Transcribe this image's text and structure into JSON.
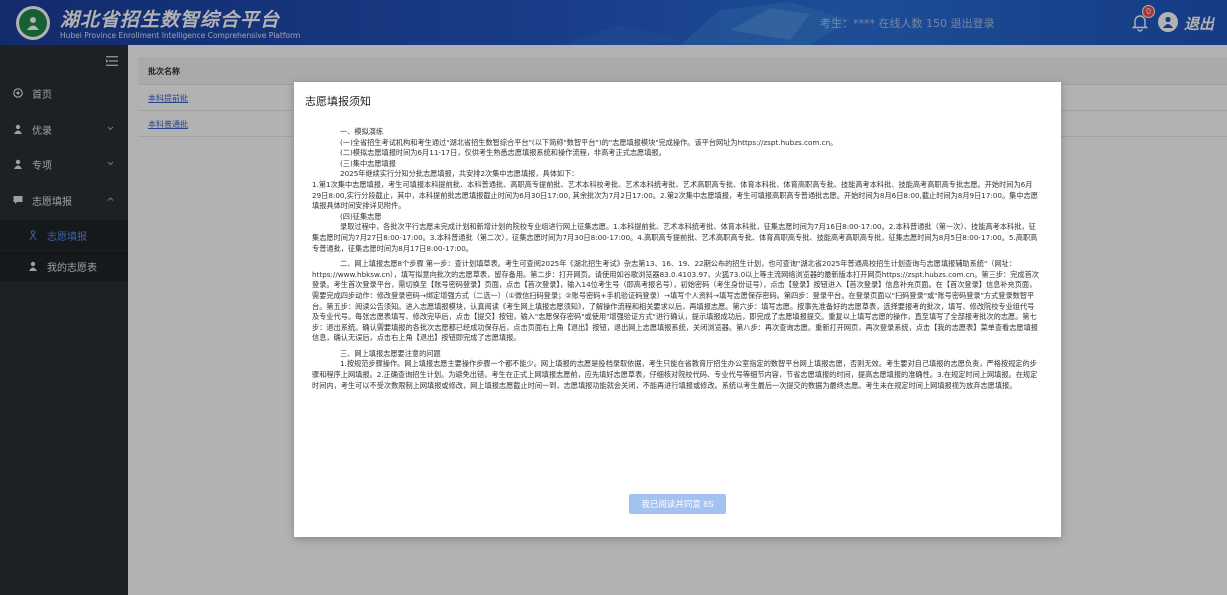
{
  "header": {
    "title": "湖北省招生数智综合平台",
    "subtitle": "Hubei Province Enrollment Intelligence Comprehensive Platform",
    "user_info": "考生：****   在线人数 150   退出登录",
    "notification_count": "0",
    "logout_label": "退出"
  },
  "sidebar": {
    "items": [
      {
        "label": "首页",
        "icon": "home-icon"
      },
      {
        "label": "优录",
        "icon": "user-icon"
      },
      {
        "label": "专项",
        "icon": "user-icon"
      },
      {
        "label": "志愿填报",
        "icon": "chat-icon"
      },
      {
        "label": "志愿填报",
        "icon": "person-icon"
      },
      {
        "label": "我的志愿表",
        "icon": "person-icon"
      }
    ]
  },
  "main": {
    "table": {
      "header": "批次名称",
      "rows": [
        "本科提前批",
        "本科普通批"
      ]
    }
  },
  "modal": {
    "title": "志愿填报须知",
    "paragraphs": [
      {
        "text": "一、模拟演练",
        "indent": true
      },
      {
        "text": "(一)全省招生考试机构和考生通过\"湖北省招生数智综合平台\"(以下简称\"数智平台\")的\"志愿填报模块\"完成操作。该平台网址为https://zspt.hubzs.com.cn。",
        "indent": true
      },
      {
        "text": "(二)模拟志愿填报时间为6月11-17日，仅供考生熟悉志愿填报系统和操作流程，非高考正式志愿填报。",
        "indent": true
      },
      {
        "text": "(三)集中志愿填报",
        "indent": true
      },
      {
        "text": "2025年继续实行分知分批志愿填报，共安排2次集中志愿填报，具体如下：",
        "indent": true
      },
      {
        "text": "1.第1次集中志愿填报，考生可填报本科提前批、本科普通批、高职高专提前批、艺术本科校考批、艺术本科统考批、艺术高职高专批、体育本科批、体育高职高专批、技能高考本科批、技能高考高职高专批志愿。开始时间为6月29日8:00,实行分段截止，其中，本科提前批志愿填报截止时间为6月30日17:00, 其余批次为7月2日17:00。2.第2次集中志愿填报，考生可填报高职高专普通批志愿。开始时间为8月6日8:00,截止时间为8月9日17:00。集中志愿填报具体时间安排详见附件。",
        "indent": false
      },
      {
        "text": "(四)征集志愿",
        "indent": true
      },
      {
        "text": "录取过程中，各批次平行志愿未完成计划和新增计划的院校专业组进行网上征集志愿。1.本科提前批、艺术本科统考批、体育本科批，征集志愿时间为7月16日8:00-17:00。2.本科普通批（第一次）、技能高考本科批，征集志愿时间为7月27日8:00-17:00。3.本科普通批（第二次），征集志愿时间为7月30日8:00-17:00。4.高职高专提前批、艺术高职高专批、体育高职高专批、技能高考高职高专批，征集志愿时间为8月5日8:00-17:00。5.高职高专普通批，征集志愿时间为8月17日8:00-17:00。",
        "indent": true
      },
      {
        "text": "",
        "indent": false
      },
      {
        "text": "二、网上填报志愿8个步骤 第一步：查计划填草表。考生可查阅2025年《湖北招生考试》杂志第13、16、19、22期公布的招生计划，也可查询\"湖北省2025年普通高校招生计划查询与志愿填报辅助系统\"（网址：https://www.hbksw.cn），填写拟意向批次的志愿草表，留存备用。第二步：打开网页。请使用如谷歌浏览器83.0.4103.97、火狐73.0以上等主流网络浏览器的最新版本打开网页https://zspt.hubzs.com.cn。第三步：完成首次登录。考生首次登录平台，需切换至【账号密码登录】页面，点击【首次登录】，输入14位考生号（即高考报名号），初始密码（考生身份证号），点击【登录】按钮进入【首次登录】信息补充页面。在【首次登录】信息补充页面，需要完成四步动作：修改登录密码→绑定增强方式（二选一）（①微信扫码登录；②账号密码+手机验证码登录）→填写个人资料→填写志愿保存密码。第四步：登录平台。在登录页面以\"扫码登录\"或\"账号密码登录\"方式登录数智平台。第五步：阅读公告须知。进入志愿填报模块，认真阅读《考生网上填报志愿须知》，了解操作流程和相关要求以后，再填报志愿。第六步：填写志愿。按事先准备好的志愿草表，选择要报考的批次，填写、修改院校专业组代号及专业代号。每张志愿表填写、修改完毕后，点击【提交】按钮，输入\"志愿保存密码\"或使用\"增强验证方式\"进行确认，提示填报成功后，即完成了志愿填报提交。重复以上填写志愿的操作，直至填写了全部报考批次的志愿。第七步：退出系统。确认需要填报的各批次志愿都已经成功保存后，点击页面右上角【退出】按钮，退出网上志愿填报系统，关闭浏览器。第八步：再次查询志愿。重新打开网页，再次登录系统，点击【我的志愿表】菜单查看志愿填报信息，确认无误后，点击右上角【退出】按钮即完成了志愿填报。",
        "indent": true
      },
      {
        "text": "",
        "indent": false
      },
      {
        "text": "三、网上填报志愿要注意的问题",
        "indent": true
      },
      {
        "text": "1.按规范步骤操作。网上填报志愿主要操作步骤一个都不能少。网上填报的志愿是投档录取依据，考生只能在省教育厅招生办公室指定的数智平台网上填报志愿，否则无效。考生要对自己填报的志愿负责，严格按规定的步骤和程序上网填报。2.正确查询招生计划。为避免出错，考生在正式上网填报志愿前，应先填好志愿草表，仔细核对院校代码、专业代号等细节内容，节省志愿填报的时间，提高志愿填报的准确性。3.在规定时间上网填报。在规定时间内，考生可以不受次数限制上网填报或修改，网上填报志愿截止时间一到，志愿填报功能就会关闭，不能再进行填报或修改。系统以考生最后一次提交的数据为最终志愿。考生未在规定时间上网填报视为放弃志愿填报。",
        "indent": true
      }
    ],
    "agree_button": "我已阅读并同意 8S"
  },
  "colors": {
    "header": "#2457c4",
    "sidebar": "#2a3034",
    "active_menu": "#5b8cf0",
    "agree_button": "#a4c2f0",
    "link": "#3a62c9"
  }
}
